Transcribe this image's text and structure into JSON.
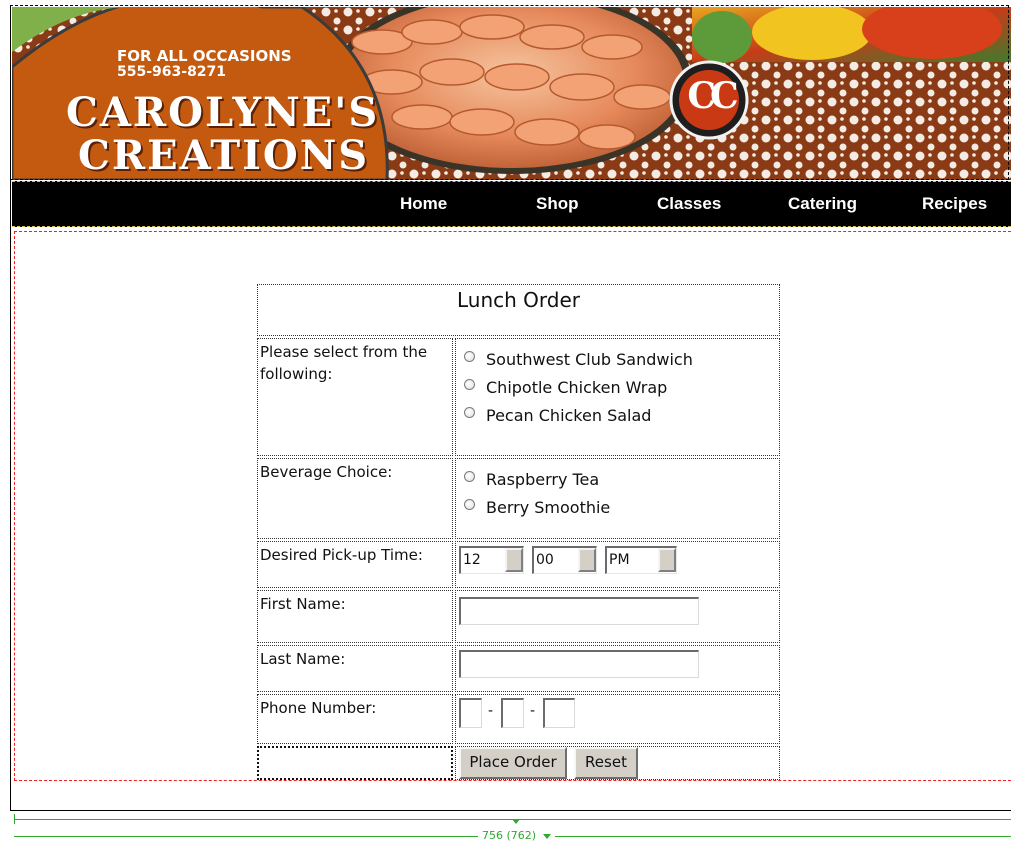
{
  "brand": {
    "tagline": "FOR ALL OCCASIONS",
    "phone": "555-963-8271",
    "name_line1": "CAROLYNE'S",
    "name_line2": "CREATIONS",
    "monogram": "CC"
  },
  "nav": {
    "items": [
      "Home",
      "Shop",
      "Classes",
      "Catering",
      "Recipes"
    ]
  },
  "form": {
    "title": "Lunch Order",
    "menu_label": "Please select from the following:",
    "menu_options": [
      "Southwest Club Sandwich",
      "Chipotle Chicken Wrap",
      "Pecan Chicken Salad"
    ],
    "beverage_label": "Beverage Choice:",
    "beverage_options": [
      "Raspberry Tea",
      "Berry Smoothie"
    ],
    "pickup_label": "Desired Pick-up Time:",
    "pickup_hour": "12",
    "pickup_minute": "00",
    "pickup_period": "PM",
    "first_name_label": "First Name:",
    "first_name_value": "",
    "last_name_label": "Last Name:",
    "last_name_value": "",
    "phone_label": "Phone Number:",
    "phone_separator": "-",
    "submit_label": "Place Order",
    "reset_label": "Reset"
  },
  "ruler": {
    "label": "756 (762)"
  },
  "colors": {
    "banner_brown": "#8a3a14",
    "banner_orange": "#c45a10",
    "nav_bg": "#000000",
    "content_outline": "#ee2222",
    "ruler": "#2ea82e"
  },
  "icons": [
    "radio-button-icon",
    "dropdown-arrow-icon",
    "monogram-logo-icon"
  ]
}
